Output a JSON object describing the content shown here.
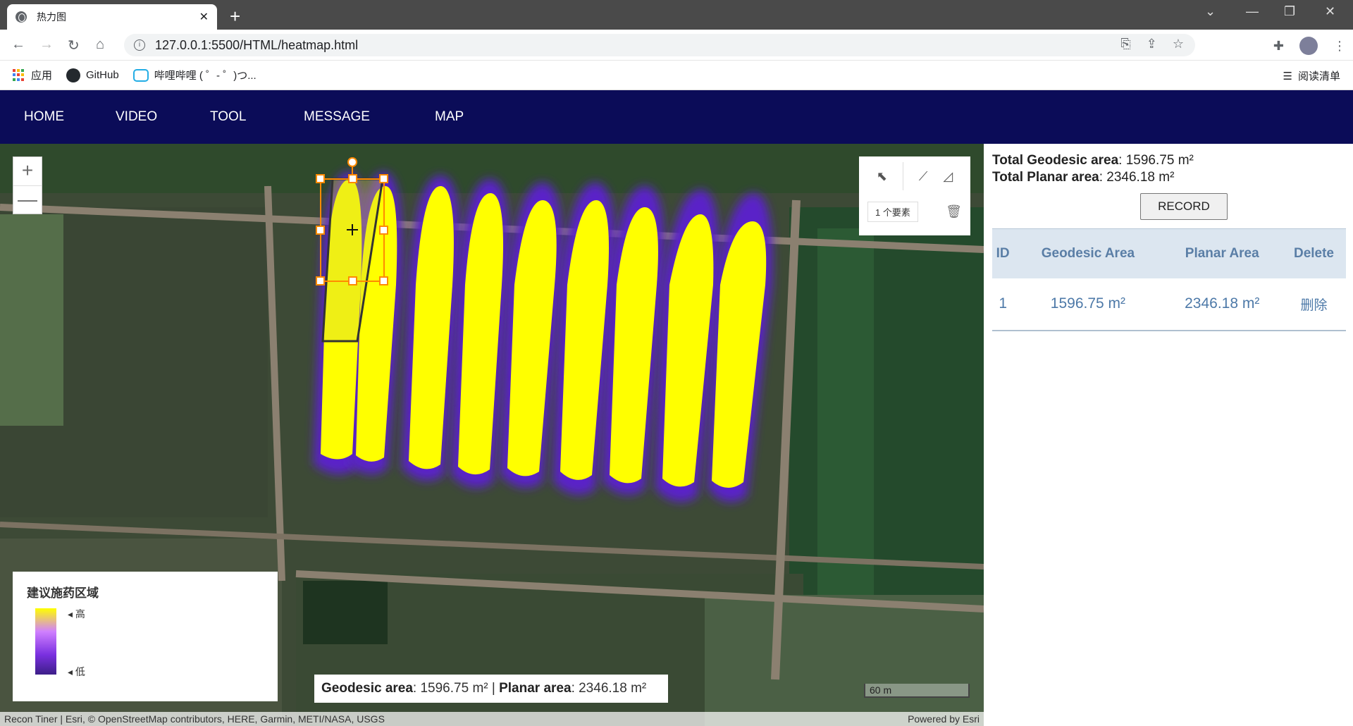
{
  "browser": {
    "tab_title": "热力图",
    "tab_close": "✕",
    "new_tab": "+",
    "url": "127.0.0.1:5500/HTML/heatmap.html",
    "bookmarks": [
      {
        "label": "应用"
      },
      {
        "label": "GitHub"
      },
      {
        "label": "哔哩哔哩 ( ゜- ゜)つ..."
      }
    ],
    "reading_list": "阅读清单"
  },
  "nav": {
    "items": [
      "HOME",
      "VIDEO",
      "TOOL",
      "MESSAGE",
      "MAP"
    ]
  },
  "map": {
    "zoom_in": "+",
    "zoom_out": "—",
    "sketch_count": "1 个要素",
    "legend": {
      "title": "建议施药区域",
      "high": "高",
      "low": "低",
      "colors": [
        "#ffff00",
        "#d080ff",
        "#7a30e0",
        "#3c1e88"
      ]
    },
    "area_label": {
      "geodesic_label": "Geodesic area",
      "geodesic_value": ": 1596.75 m² | ",
      "planar_label": "Planar area",
      "planar_value": ": 2346.18 m²"
    },
    "scale": "60 m",
    "attribution": "Recon Tiner | Esri, © OpenStreetMap contributors, HERE, Garmin, METI/NASA, USGS",
    "powered_by": "Powered by Esri"
  },
  "panel": {
    "total_geodesic_label": "Total Geodesic area",
    "total_geodesic_value": ": 1596.75 m²",
    "total_planar_label": "Total Planar area",
    "total_planar_value": ": 2346.18 m²",
    "record_button": "RECORD",
    "table": {
      "headers": [
        "ID",
        "Geodesic Area",
        "Planar Area",
        "Delete"
      ],
      "rows": [
        {
          "id": "1",
          "geodesic": "1596.75 m²",
          "planar": "2346.18 m²",
          "delete": "删除"
        }
      ]
    }
  }
}
